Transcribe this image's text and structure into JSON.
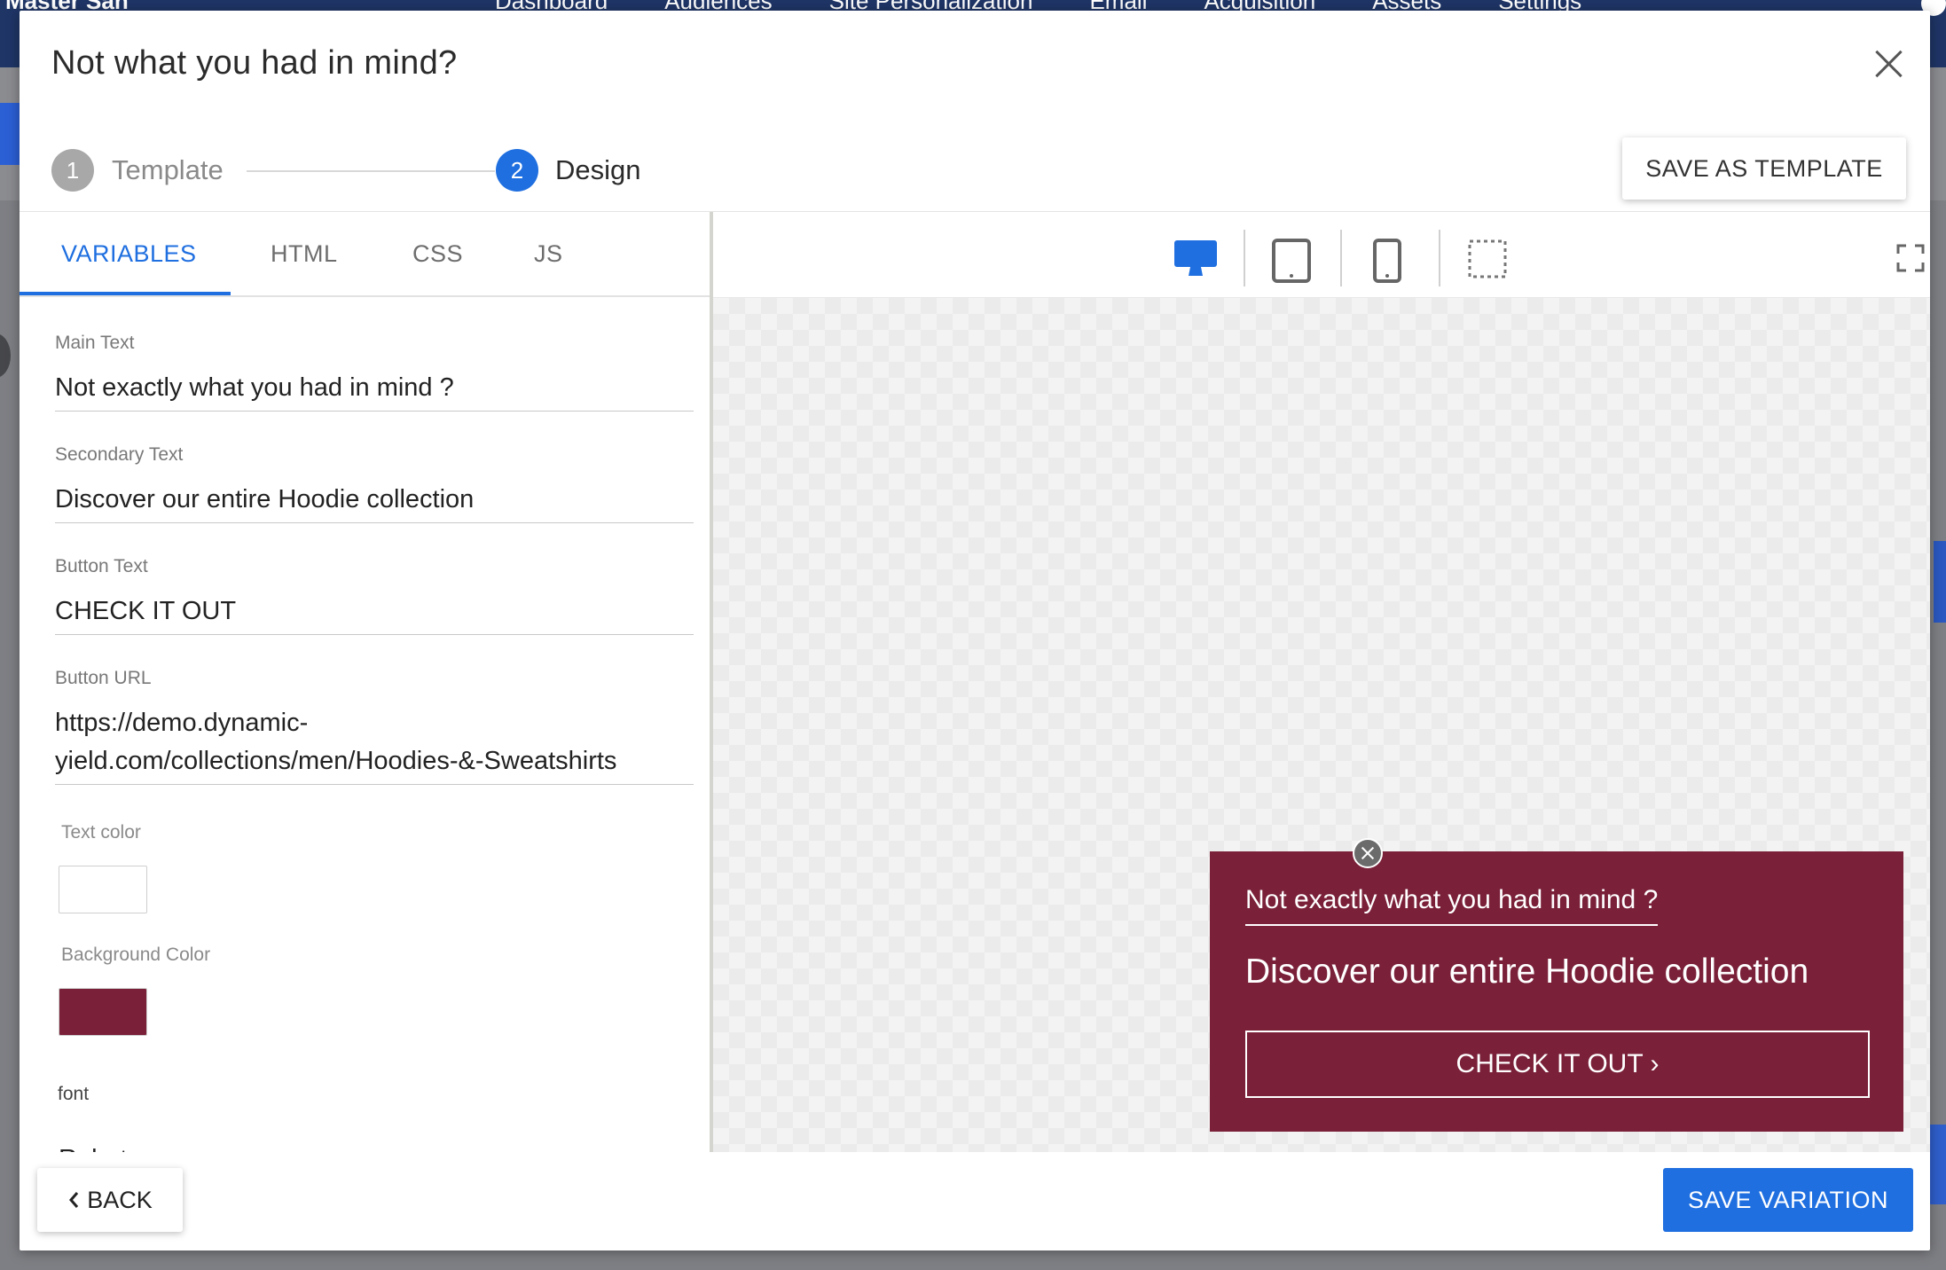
{
  "background_app": {
    "brand": "Master San",
    "nav": [
      "Dashboard",
      "Audiences",
      "Site Personalization",
      "Email",
      "Acquisition",
      "Assets",
      "Settings"
    ]
  },
  "modal": {
    "title": "Not what you had in mind?",
    "steps": [
      {
        "number": "1",
        "label": "Template",
        "state": "completed"
      },
      {
        "number": "2",
        "label": "Design",
        "state": "active"
      }
    ],
    "save_template_label": "SAVE AS TEMPLATE",
    "tabs": [
      {
        "label": "VARIABLES",
        "active": true
      },
      {
        "label": "HTML",
        "active": false
      },
      {
        "label": "CSS",
        "active": false
      },
      {
        "label": "JS",
        "active": false
      }
    ],
    "variables": {
      "main_text": {
        "label": "Main Text",
        "value": "Not exactly what you had in mind ?"
      },
      "secondary_text": {
        "label": "Secondary Text",
        "value": "Discover our entire Hoodie collection"
      },
      "button_text": {
        "label": "Button Text",
        "value": "CHECK IT OUT"
      },
      "button_url": {
        "label": "Button URL",
        "value": "https://demo.dynamic-yield.com/collections/men/Hoodies-&-Sweatshirts"
      },
      "text_color": {
        "label": "Text color",
        "value": "#ffffff"
      },
      "background_color": {
        "label": "Background Color",
        "value": "#7a2039"
      },
      "font": {
        "label": "font",
        "value": "Roboto"
      }
    },
    "device_toolbar": [
      "desktop-icon",
      "tablet-icon",
      "mobile-icon",
      "custom-size-icon",
      "fullscreen-icon"
    ],
    "preview": {
      "main_text": "Not exactly what you had in mind ?",
      "secondary_text": "Discover our entire Hoodie collection",
      "button_label": "CHECK IT OUT ›"
    },
    "back_label": "BACK",
    "save_variation_label": "SAVE VARIATION"
  },
  "colors": {
    "accent": "#1f6fe0",
    "popup_bg": "#7a2039",
    "header_bg": "#1f3566"
  }
}
